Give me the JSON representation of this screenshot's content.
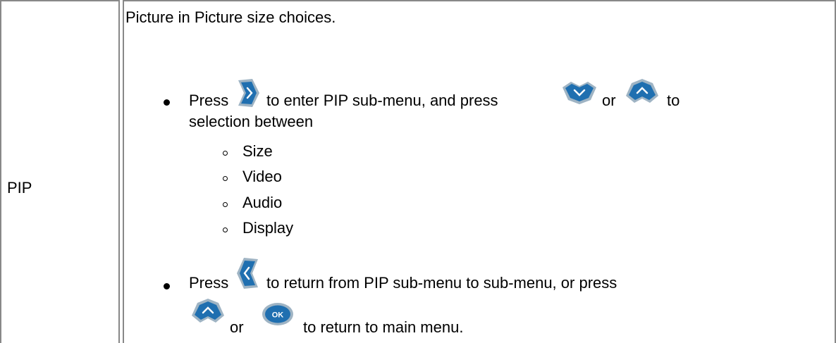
{
  "table": {
    "row_label": "PIP",
    "description": "Picture in Picture size choices."
  },
  "bullets": [
    {
      "press": "Press",
      "line1_mid": "to enter PIP sub-menu, and press",
      "or": "or",
      "to": "to",
      "line2": "selection between",
      "icons": [
        "right-arrow-button",
        "down-arrow-button",
        "up-arrow-button"
      ]
    },
    {
      "press": "Press",
      "line1_mid": "to return from PIP sub-menu to sub-menu, or press",
      "or": "or",
      "line2_end": "to return to main menu.",
      "icons": [
        "left-arrow-button",
        "up-arrow-button",
        "ok-button"
      ]
    }
  ],
  "sub_items": [
    "Size",
    "Video",
    "Audio",
    "Display"
  ],
  "colors": {
    "button_blue": "#1f6fb0",
    "button_shell": "#8fa9bd",
    "border": "#888888"
  }
}
